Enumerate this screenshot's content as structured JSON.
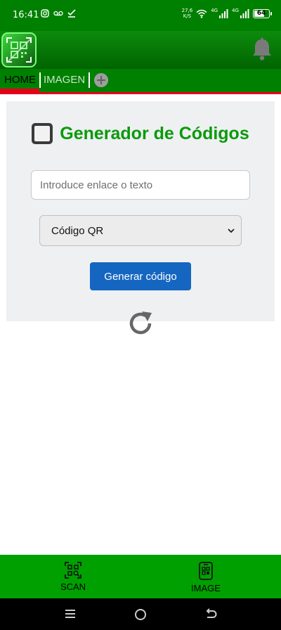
{
  "status_bar": {
    "time": "16:41",
    "net_speed_value": "27,6",
    "net_speed_unit": "K/S",
    "signal1_label": "4G",
    "signal2_label": "4G",
    "battery": "64"
  },
  "tabs": {
    "home": "HOME",
    "image": "IMAGEN"
  },
  "card": {
    "title": "Generador de Códigos",
    "input_placeholder": "Introduce enlace o texto",
    "input_value": "",
    "select_value": "Código QR",
    "button_label": "Generar código"
  },
  "bottom_nav": {
    "scan": "SCAN",
    "image": "IMAGE"
  },
  "colors": {
    "brand_green": "#008000",
    "title_green": "#0a9a0a",
    "accent_red": "#e4001b",
    "button_blue": "#1566c0"
  }
}
